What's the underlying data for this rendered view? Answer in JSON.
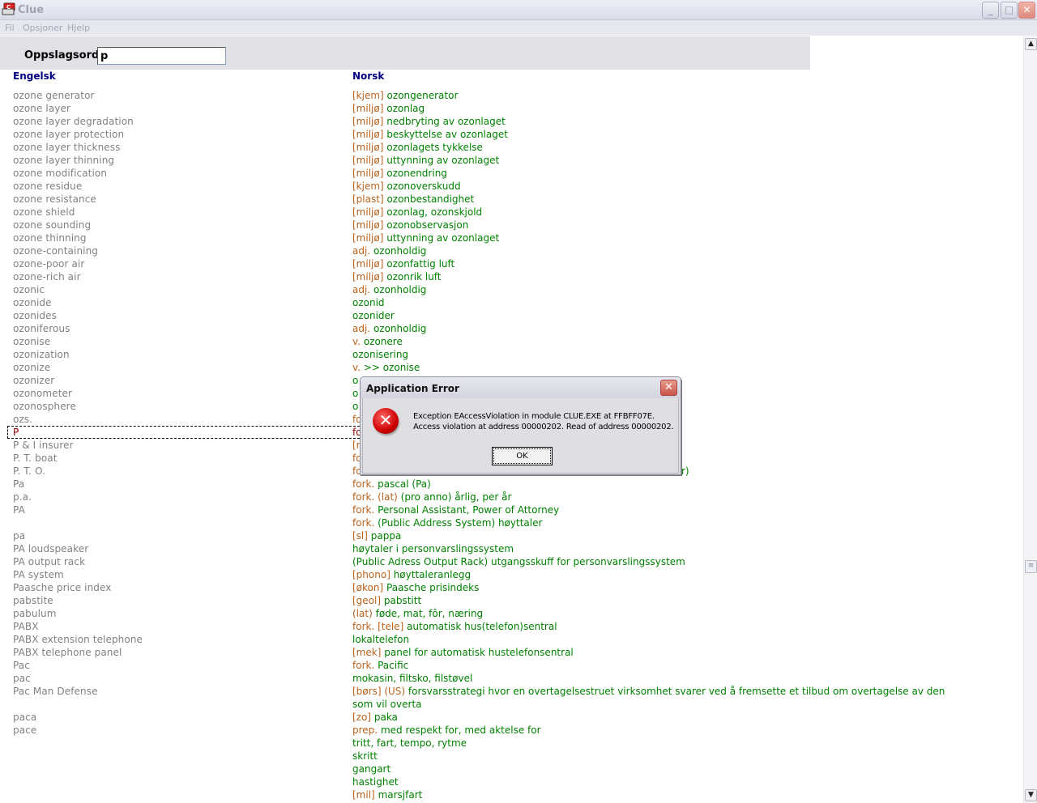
{
  "window": {
    "title": "Clue",
    "minimize": "_",
    "maximize": "□",
    "close": "✕"
  },
  "menu": [
    "Fil",
    "Opsjoner",
    "Hjelp"
  ],
  "search": {
    "label": "Oppslagsord:",
    "value": "p"
  },
  "columns": {
    "english": "Engelsk",
    "norwegian": "Norsk"
  },
  "rows": [
    {
      "en": "ozone generator",
      "tag": "[kjem]",
      "text": "ozongenerator"
    },
    {
      "en": "ozone layer",
      "tag": "[miljø]",
      "text": "ozonlag"
    },
    {
      "en": "ozone layer degradation",
      "tag": "[miljø]",
      "text": "nedbryting av ozonlaget"
    },
    {
      "en": "ozone layer protection",
      "tag": "[miljø]",
      "text": "beskyttelse av ozonlaget"
    },
    {
      "en": "ozone layer thickness",
      "tag": "[miljø]",
      "text": "ozonlagets tykkelse"
    },
    {
      "en": "ozone layer thinning",
      "tag": "[miljø]",
      "text": "uttynning av ozonlaget"
    },
    {
      "en": "ozone modification",
      "tag": "[miljø]",
      "text": "ozonendring"
    },
    {
      "en": "ozone residue",
      "tag": "[kjem]",
      "text": "ozonoverskudd"
    },
    {
      "en": "ozone resistance",
      "tag": "[plast]",
      "text": "ozonbestandighet"
    },
    {
      "en": "ozone shield",
      "tag": "[miljø]",
      "text": "ozonlag, ozonskjold"
    },
    {
      "en": "ozone sounding",
      "tag": "[miljø]",
      "text": "ozonobservasjon"
    },
    {
      "en": "ozone thinning",
      "tag": "[miljø]",
      "text": "uttynning av ozonlaget"
    },
    {
      "en": "ozone-containing",
      "tag": "adj.",
      "text": "ozonholdig"
    },
    {
      "en": "ozone-poor air",
      "tag": "[miljø]",
      "text": "ozonfattig luft"
    },
    {
      "en": "ozone-rich air",
      "tag": "[miljø]",
      "text": "ozonrik luft"
    },
    {
      "en": "ozonic",
      "tag": "adj.",
      "text": "ozonholdig"
    },
    {
      "en": "ozonide",
      "tag": "",
      "text": "ozonid"
    },
    {
      "en": "ozonides",
      "tag": "",
      "text": "ozonider"
    },
    {
      "en": "ozoniferous",
      "tag": "adj.",
      "text": "ozonholdig"
    },
    {
      "en": "ozonise",
      "tag": "v.",
      "text": "ozonere"
    },
    {
      "en": "ozonization",
      "tag": "",
      "text": "ozonisering"
    },
    {
      "en": "ozonize",
      "tag": "v.",
      "text": ">> ozonise"
    },
    {
      "en": "ozonizer",
      "tag": "",
      "text": "o"
    },
    {
      "en": "ozonometer",
      "tag": "",
      "text": "o"
    },
    {
      "en": "ozonosphere",
      "tag": "",
      "text": "o"
    },
    {
      "en": "ozs.",
      "tag": "fo",
      "text": ""
    },
    {
      "en": "P",
      "tag": "fo",
      "text": "",
      "selected": true
    },
    {
      "en": "P & I insurer",
      "tag": "[r",
      "text": ""
    },
    {
      "en": "P. T. boat",
      "tag": "fo",
      "text": ""
    },
    {
      "en": "P. T. O.",
      "tag": "fo",
      "text": "",
      "tail": "r)"
    },
    {
      "en": "Pa",
      "tag": "fork.",
      "text": "pascal (Pa)"
    },
    {
      "en": "p.a.",
      "tag": "fork. (lat)",
      "text": "(pro anno) årlig, per år"
    },
    {
      "en": "PA",
      "tag": "fork.",
      "text": "Personal Assistant, Power of Attorney"
    },
    {
      "en": "",
      "tag": "fork.",
      "text": "(Public Address System) høyttaler"
    },
    {
      "en": "pa",
      "tag": "[sl]",
      "text": "pappa"
    },
    {
      "en": "PA loudspeaker",
      "tag": "",
      "text": "høytaler i personvarslingssystem"
    },
    {
      "en": "PA output rack",
      "tag": "",
      "text": "(Public Adress Output Rack)  utgangsskuff for personvarslingssystem"
    },
    {
      "en": "PA system",
      "tag": "[phono]",
      "text": "høyttaleranlegg"
    },
    {
      "en": "Paasche price index",
      "tag": "[økon]",
      "text": "Paasche prisindeks"
    },
    {
      "en": "pabstite",
      "tag": "[geol]",
      "text": "pabstitt"
    },
    {
      "en": "pabulum",
      "tag": "(lat)",
      "text": "føde, mat, fôr, næring"
    },
    {
      "en": "PABX",
      "tag": "fork. [tele]",
      "text": "automatisk hus(telefon)sentral"
    },
    {
      "en": "PABX extension telephone",
      "tag": "",
      "text": "lokaltelefon"
    },
    {
      "en": "PABX telephone panel",
      "tag": "[mek]",
      "text": "panel for automatisk hustelefonsentral"
    },
    {
      "en": "Pac",
      "tag": "fork.",
      "text": "Pacific"
    },
    {
      "en": "pac",
      "tag": "",
      "text": "mokasin, filtsko, filstøvel"
    },
    {
      "en": "Pac Man Defense",
      "tag": "[børs] (US)",
      "text": "forsvarsstrategi hvor en overtagelsestruet virksomhet svarer ved å fremsette et tilbud om overtagelse av den"
    },
    {
      "en": "",
      "tag": "",
      "text": "som vil overta"
    },
    {
      "en": "paca",
      "tag": "[zo]",
      "text": "paka"
    },
    {
      "en": "pace",
      "tag": "prep.",
      "text": "med respekt for, med aktelse for"
    },
    {
      "en": "",
      "tag": "",
      "text": "tritt, fart, tempo, rytme"
    },
    {
      "en": "",
      "tag": "",
      "text": "skritt"
    },
    {
      "en": "",
      "tag": "",
      "text": "gangart"
    },
    {
      "en": "",
      "tag": "",
      "text": "hastighet"
    },
    {
      "en": "",
      "tag": "[mil]",
      "text": "marsjfart"
    }
  ],
  "dialog": {
    "title": "Application Error",
    "close": "✕",
    "icon": "error-icon",
    "message_line1": "Exception EAccessViolation in module CLUE.EXE at FFBFF07E.",
    "message_line2": "Access violation at address 00000202. Read of address 00000202.",
    "ok_label": "OK"
  },
  "scrollbar": {
    "up": "▲",
    "down": "▼",
    "thumb": "≡"
  }
}
